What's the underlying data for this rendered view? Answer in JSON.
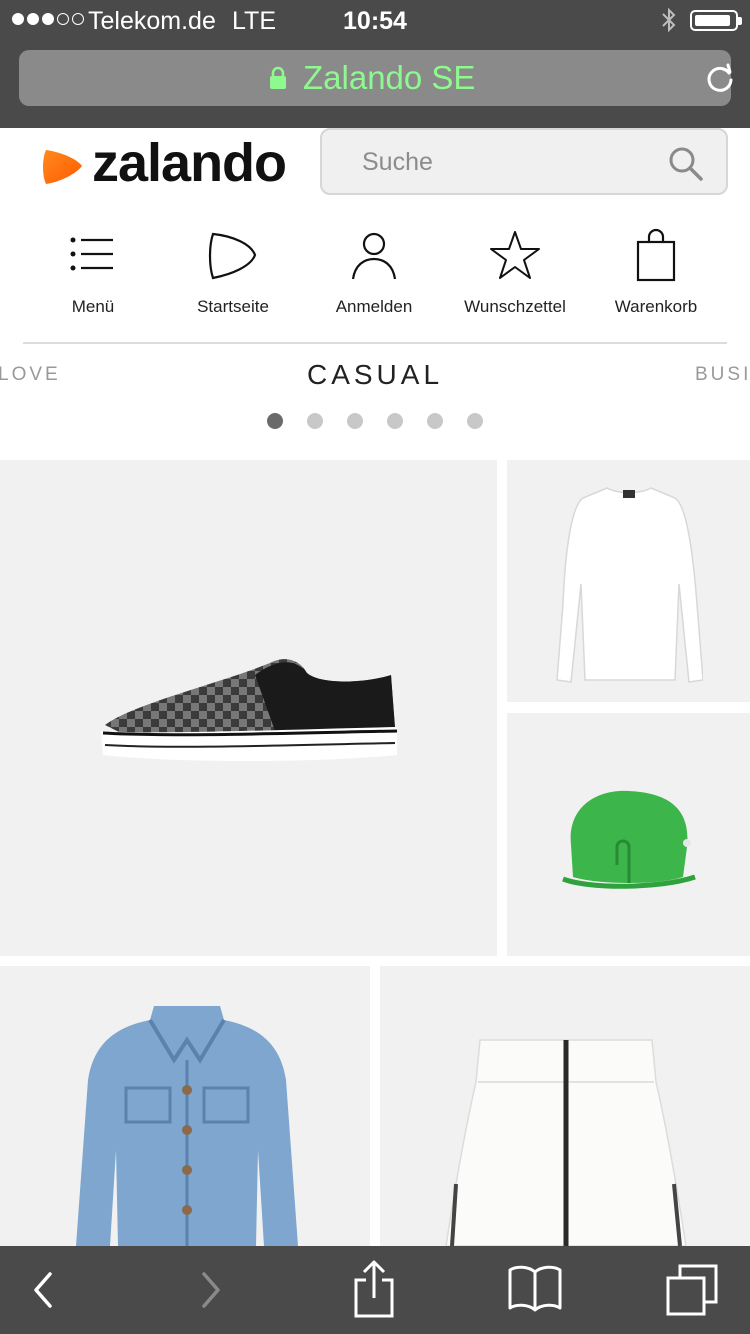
{
  "status_bar": {
    "carrier": "Telekom.de",
    "network": "LTE",
    "time": "10:54",
    "signal_bars_filled": 3,
    "signal_bars_total": 5,
    "icons": [
      "bluetooth-icon",
      "battery-icon"
    ]
  },
  "browser": {
    "url_title": "Zalando SE",
    "url_color": "#8ef98e",
    "icons": [
      "lock-icon",
      "reload-icon"
    ],
    "toolbar_icons": [
      "back-icon",
      "forward-icon",
      "share-icon",
      "bookmarks-icon",
      "tabs-icon"
    ]
  },
  "header": {
    "logo_text": "zalando",
    "logo_color": "#ff6900",
    "search_placeholder": "Suche"
  },
  "nav": {
    "items": [
      {
        "label": "Menü",
        "icon": "menu-icon"
      },
      {
        "label": "Startseite",
        "icon": "home-icon"
      },
      {
        "label": "Anmelden",
        "icon": "user-icon"
      },
      {
        "label": "Wunschzettel",
        "icon": "star-icon"
      },
      {
        "label": "Warenkorb",
        "icon": "bag-icon"
      }
    ]
  },
  "carousel": {
    "prev_category": "LOVE",
    "current_category": "CASUAL",
    "next_category": "BUSI",
    "page_count": 6,
    "active_page": 1
  },
  "products": [
    {
      "name": "checkered slip-on sneaker",
      "icon": "sneaker-image"
    },
    {
      "name": "white long-sleeve shirt",
      "icon": "shirt-image"
    },
    {
      "name": "green shoulder bag",
      "icon": "bag-image",
      "color": "#3cb54a"
    },
    {
      "name": "denim jacket",
      "icon": "jacket-image",
      "color": "#7fa6cf"
    },
    {
      "name": "white zip skirt",
      "icon": "skirt-image"
    }
  ]
}
